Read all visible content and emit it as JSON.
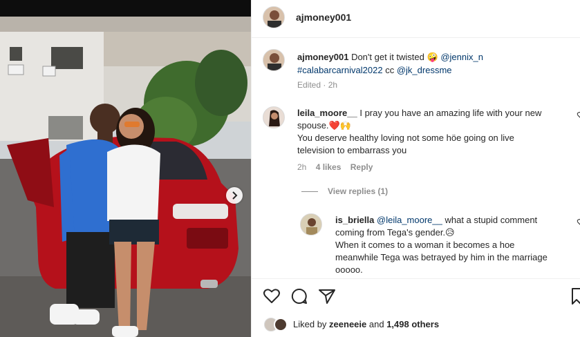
{
  "post": {
    "username": "ajmoney001",
    "caption": {
      "username": "ajmoney001",
      "text": "Don't get it twisted",
      "emoji": "🤪",
      "mention1": "@jennix_n",
      "hashtag": "#calabarcarnival2022",
      "cc": "cc",
      "mention2": "@jk_dressme",
      "meta": "Edited · 2h"
    }
  },
  "comments": [
    {
      "username": "leila_moore__",
      "line1": "I pray you have an amazing life with your new",
      "line2": "spouse.❤️🙌",
      "line3": "You deserve healthy loving not some höe going on live",
      "line4": "television to embarrass you",
      "time": "2h",
      "likes": "4 likes",
      "reply": "Reply",
      "view_replies": "View replies (1)"
    }
  ],
  "reply": {
    "username": "is_briella",
    "mention": "@leila_moore__",
    "line1_rest": "what a stupid comment",
    "line2": "coming from Tega's gender.😥",
    "line3": "When it comes to a woman it becomes a hoe",
    "line4": "meanwhile Tega was betrayed by him in the marriage",
    "line5": "ooooo."
  },
  "likes": {
    "prefix": "Liked by",
    "user": "zeeneeie",
    "and": "and",
    "count": "1,498 others"
  },
  "icons": [
    "heart-icon",
    "comment-icon",
    "share-icon",
    "bookmark-icon",
    "chevron-right-icon"
  ]
}
